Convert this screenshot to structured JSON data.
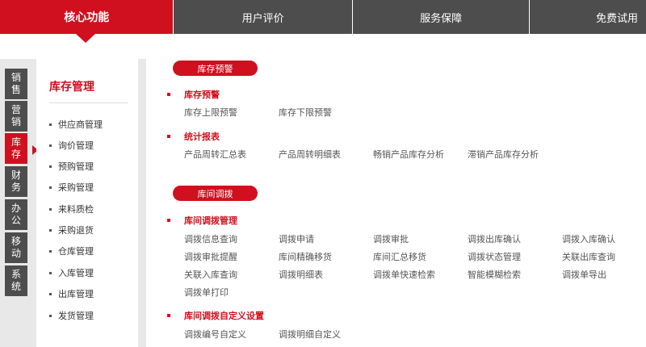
{
  "top_tabs": [
    "核心功能",
    "用户评价",
    "服务保障",
    "免费试用"
  ],
  "vertical_tabs": [
    [
      "销",
      "售"
    ],
    [
      "营",
      "销"
    ],
    [
      "库",
      "存"
    ],
    [
      "财",
      "务"
    ],
    [
      "办",
      "公"
    ],
    [
      "移",
      "动"
    ],
    [
      "系",
      "统"
    ]
  ],
  "submenu": {
    "title": "库存管理",
    "items": [
      "供应商管理",
      "询价管理",
      "预购管理",
      "采购管理",
      "来料质检",
      "采购退货",
      "仓库管理",
      "入库管理",
      "出库管理",
      "发货管理"
    ]
  },
  "sections": {
    "pill1": "库存预警",
    "g1_title": "库存预警",
    "g1_links": [
      "库存上限预警",
      "库存下限预警"
    ],
    "g2_title": "统计报表",
    "g2_links": [
      "产品周转汇总表",
      "产品周转明细表",
      "畅销产品库存分析",
      "滞销产品库存分析"
    ],
    "pill2": "库间调拨",
    "g3_title": "库间调拨管理",
    "g3_links": [
      "调拨信息查询",
      "调拨申请",
      "调拨审批",
      "调拨出库确认",
      "调拨入库确认",
      "调拨审批提醒",
      "库间精确移货",
      "库间汇总移货",
      "调拨状态管理",
      "关联出库查询",
      "关联入库查询",
      "调拨明细表",
      "调拨单快速检索",
      "智能模糊检索",
      "调拨单导出",
      "调拨单打印"
    ],
    "g4_title": "库间调拨自定义设置",
    "g4_links": [
      "调拨编号自定义",
      "调拨明细自定义"
    ]
  },
  "colors": {
    "accent": "#d0101e",
    "dark": "#4d4d4d",
    "panel": "#e8e8e8"
  }
}
